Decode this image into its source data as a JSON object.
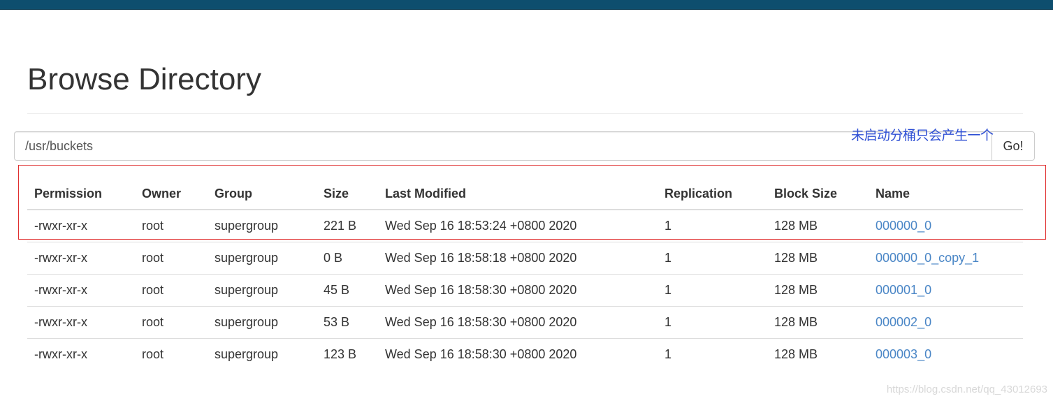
{
  "page": {
    "title": "Browse Directory"
  },
  "path_bar": {
    "value": "/usr/buckets",
    "go_label": "Go!"
  },
  "annotation": {
    "text": "未启动分桶只会产生一个",
    "color": "#2e4fd4",
    "highlight_color": "#e03030"
  },
  "table": {
    "headers": {
      "permission": "Permission",
      "owner": "Owner",
      "group": "Group",
      "size": "Size",
      "last_modified": "Last Modified",
      "replication": "Replication",
      "block_size": "Block Size",
      "name": "Name"
    },
    "rows": [
      {
        "permission": "-rwxr-xr-x",
        "owner": "root",
        "group": "supergroup",
        "size": "221 B",
        "last_modified": "Wed Sep 16 18:53:24 +0800 2020",
        "replication": "1",
        "block_size": "128 MB",
        "name": "000000_0"
      },
      {
        "permission": "-rwxr-xr-x",
        "owner": "root",
        "group": "supergroup",
        "size": "0 B",
        "last_modified": "Wed Sep 16 18:58:18 +0800 2020",
        "replication": "1",
        "block_size": "128 MB",
        "name": "000000_0_copy_1"
      },
      {
        "permission": "-rwxr-xr-x",
        "owner": "root",
        "group": "supergroup",
        "size": "45 B",
        "last_modified": "Wed Sep 16 18:58:30 +0800 2020",
        "replication": "1",
        "block_size": "128 MB",
        "name": "000001_0"
      },
      {
        "permission": "-rwxr-xr-x",
        "owner": "root",
        "group": "supergroup",
        "size": "53 B",
        "last_modified": "Wed Sep 16 18:58:30 +0800 2020",
        "replication": "1",
        "block_size": "128 MB",
        "name": "000002_0"
      },
      {
        "permission": "-rwxr-xr-x",
        "owner": "root",
        "group": "supergroup",
        "size": "123 B",
        "last_modified": "Wed Sep 16 18:58:30 +0800 2020",
        "replication": "1",
        "block_size": "128 MB",
        "name": "000003_0"
      }
    ]
  },
  "watermark": {
    "text": "https://blog.csdn.net/qq_43012693"
  },
  "colors": {
    "topbar": "#0e4e6e",
    "link": "#4a86c6"
  }
}
